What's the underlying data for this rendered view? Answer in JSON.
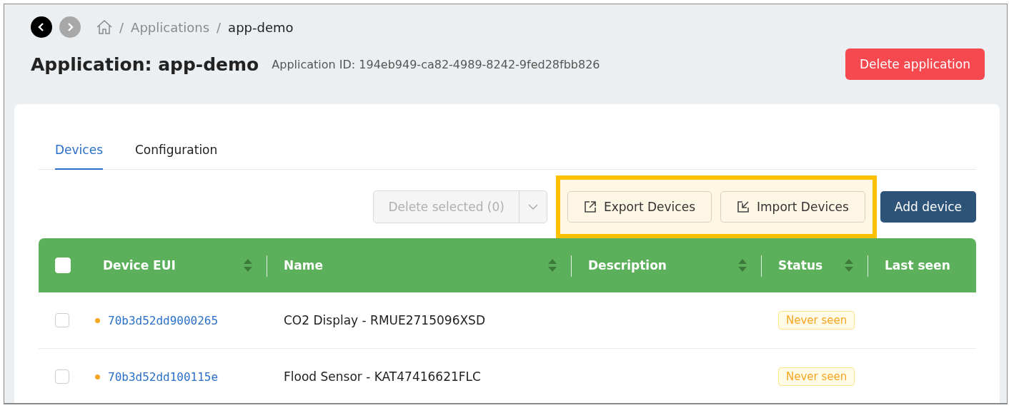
{
  "breadcrumb": {
    "items": [
      {
        "separator": "/",
        "label": "Applications"
      },
      {
        "separator": "/",
        "label": "app-demo"
      }
    ]
  },
  "header": {
    "title": "Application: app-demo",
    "subtitle": "Application ID: 194eb949-ca82-4989-8242-9fed28fbb826",
    "delete_button": "Delete application"
  },
  "tabs": [
    {
      "label": "Devices",
      "selected": true
    },
    {
      "label": "Configuration",
      "selected": false
    }
  ],
  "toolbar": [
    {
      "kind": "split",
      "label": "Delete selected (0)",
      "disabled": true,
      "highlighted": false
    },
    {
      "kind": "export",
      "label": "Export Devices",
      "highlighted": true
    },
    {
      "kind": "import",
      "label": "Import Devices",
      "highlighted": true
    },
    {
      "kind": "primary",
      "label": "Add device",
      "highlighted": false
    }
  ],
  "table": {
    "all_checked": false,
    "columns": [
      {
        "label": "Device EUI",
        "sortable": true
      },
      {
        "label": "Name",
        "sortable": true
      },
      {
        "label": "Description",
        "sortable": true
      },
      {
        "label": "Status",
        "sortable": true
      },
      {
        "label": "Last seen",
        "sortable": false
      }
    ],
    "rows": [
      {
        "checked": false,
        "color": "#f5a623",
        "eui": "70b3d52dd9000265",
        "name": "CO2 Display - RMUE2715096XSD",
        "status": "Never seen"
      },
      {
        "checked": false,
        "color": "#f5a623",
        "eui": "70b3d52dd100115e",
        "name": "Flood Sensor - KAT47416621FLC",
        "status": "Never seen"
      }
    ]
  }
}
